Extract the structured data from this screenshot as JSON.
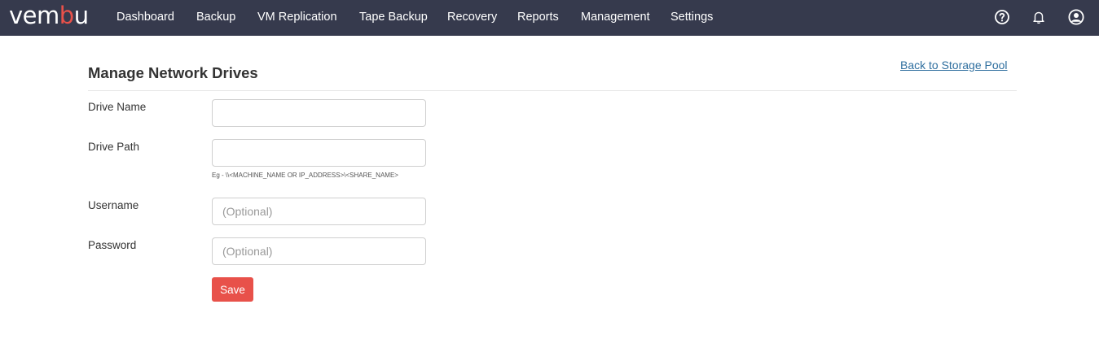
{
  "header": {
    "logo_pre": "vem",
    "logo_accent": "b",
    "logo_post": "u",
    "nav": [
      "Dashboard",
      "Backup",
      "VM Replication",
      "Tape Backup",
      "Recovery",
      "Reports",
      "Management",
      "Settings"
    ],
    "icons": [
      "help-icon",
      "bell-icon",
      "user-icon"
    ]
  },
  "page": {
    "title": "Manage Network Drives",
    "back_link": "Back to Storage Pool"
  },
  "form": {
    "drive_name": {
      "label": "Drive Name",
      "value": "",
      "placeholder": ""
    },
    "drive_path": {
      "label": "Drive Path",
      "value": "",
      "placeholder": "",
      "hint": "Eg - \\\\<MACHINE_NAME OR IP_ADDRESS>\\<SHARE_NAME>"
    },
    "username": {
      "label": "Username",
      "value": "",
      "placeholder": "(Optional)"
    },
    "password": {
      "label": "Password",
      "value": "",
      "placeholder": "(Optional)"
    },
    "save_label": "Save"
  },
  "colors": {
    "topbar": "#363a4d",
    "accent": "#e8514a",
    "link": "#2f6f9f"
  }
}
